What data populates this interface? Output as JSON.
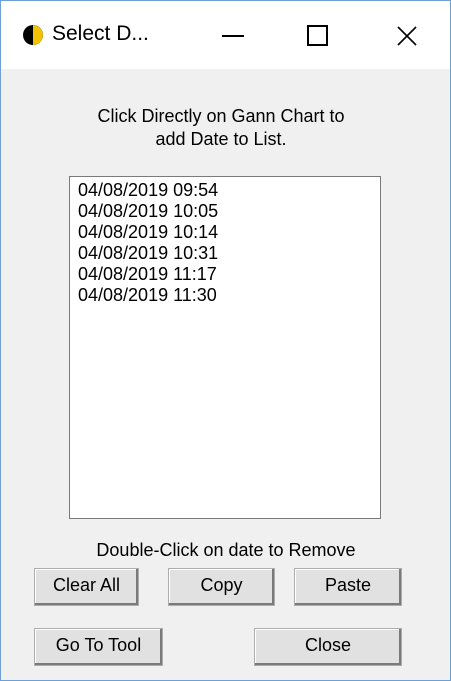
{
  "window": {
    "title": "Select D...",
    "icon": "moon-phase-icon"
  },
  "instructions": "Click Directly on Gann Chart to\nadd Date to List.",
  "dates": [
    "04/08/2019 09:54",
    "04/08/2019 10:05",
    "04/08/2019 10:14",
    "04/08/2019 10:31",
    "04/08/2019 11:17",
    "04/08/2019 11:30"
  ],
  "hint": "Double-Click on date to Remove",
  "buttons": {
    "clear_all": "Clear All",
    "copy": "Copy",
    "paste": "Paste",
    "go_to_tool": "Go To Tool",
    "close": "Close"
  },
  "colors": {
    "window_border": "#6e9fd6",
    "background": "#f0f0f0",
    "button_face": "#e1e1e1",
    "icon_light": "#f2c200",
    "icon_dark": "#000000"
  }
}
